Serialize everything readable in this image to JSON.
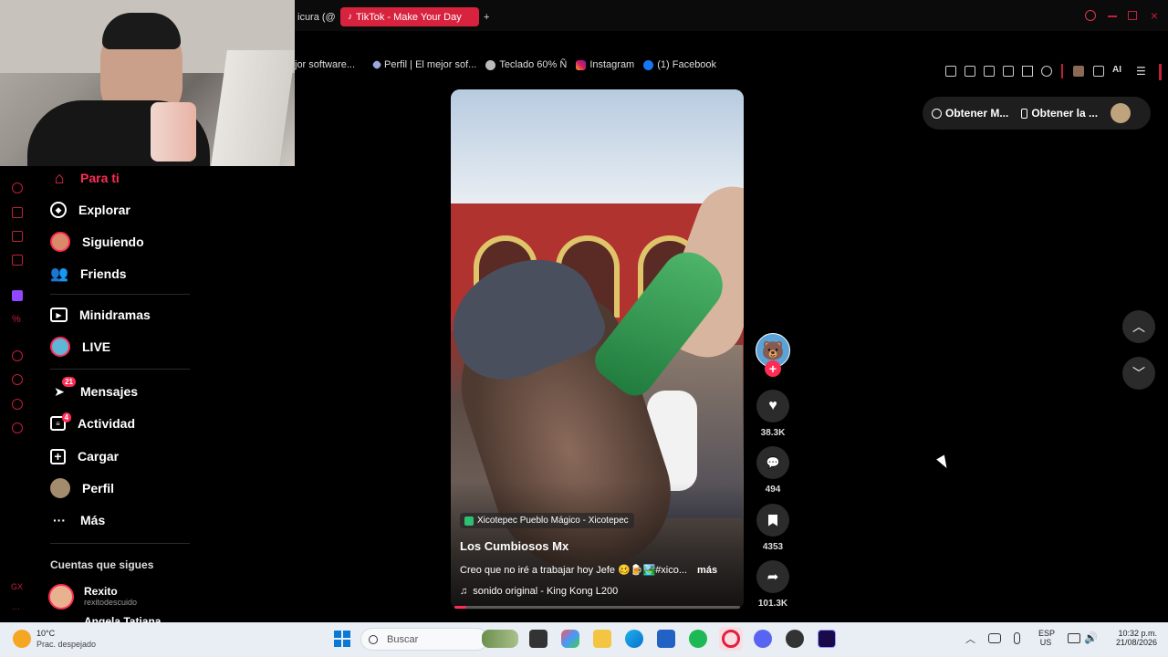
{
  "browser": {
    "tabs": [
      {
        "label": "icura (@",
        "active": false
      },
      {
        "label": "TikTok - Make Your Day",
        "active": true
      }
    ],
    "new_tab": "+",
    "ai_label": "AI",
    "bookmarks": [
      {
        "label": "jor software...",
        "icon": "generic-icon"
      },
      {
        "label": "Perfil | El mejor sof...",
        "icon": "diamond-icon"
      },
      {
        "label": "Teclado 60% Ñ",
        "icon": "keyboard-icon"
      },
      {
        "label": "Instagram",
        "icon": "instagram-icon"
      },
      {
        "label": "(1) Facebook",
        "icon": "facebook-icon"
      }
    ]
  },
  "nav": {
    "items": [
      {
        "label": "Para ti",
        "icon": "home-icon"
      },
      {
        "label": "Explorar",
        "icon": "compass-icon"
      },
      {
        "label": "Siguiendo",
        "icon": "following-avatar-icon"
      },
      {
        "label": "Friends",
        "icon": "friends-icon"
      },
      {
        "label": "Minidramas",
        "icon": "film-icon"
      },
      {
        "label": "LIVE",
        "icon": "live-icon"
      },
      {
        "label": "Mensajes",
        "icon": "paper-plane-icon",
        "badge": "21"
      },
      {
        "label": "Actividad",
        "icon": "activity-icon",
        "badge": "4"
      },
      {
        "label": "Cargar",
        "icon": "plus-square-icon"
      },
      {
        "label": "Perfil",
        "icon": "profile-avatar-icon"
      },
      {
        "label": "Más",
        "icon": "more-icon"
      }
    ],
    "following_heading": "Cuentas que sigues",
    "following": [
      {
        "name": "Rexito",
        "handle": "rexitodescuido"
      },
      {
        "name": "Angela Tatiana"
      }
    ]
  },
  "video": {
    "location": "Xicotepec Pueblo Mágico - Xicotepec",
    "author": "Los Cumbiosos Mx",
    "caption": "Creo que no iré a trabajar hoy Jefe 🥴🍺🏞️#xico...",
    "more_label": "más",
    "sound": "sonido original - King Kong L200",
    "progress": 0.04
  },
  "actions": {
    "likes": "38.3K",
    "comments": "494",
    "saves": "4353",
    "shares": "101.3K"
  },
  "top_pill": {
    "app_label": "Obtener M...",
    "mobile_label": "Obtener la ..."
  },
  "taskbar": {
    "weather_temp": "10°C",
    "weather_desc": "Prac. despejado",
    "search_placeholder": "Buscar",
    "lang_top": "ESP",
    "lang_bottom": "US",
    "time": "10:32 p.m.",
    "date": "21/08/2026"
  },
  "colors": {
    "accent": "#fe2c55",
    "opera_red": "#c0203a",
    "background": "#000000"
  }
}
